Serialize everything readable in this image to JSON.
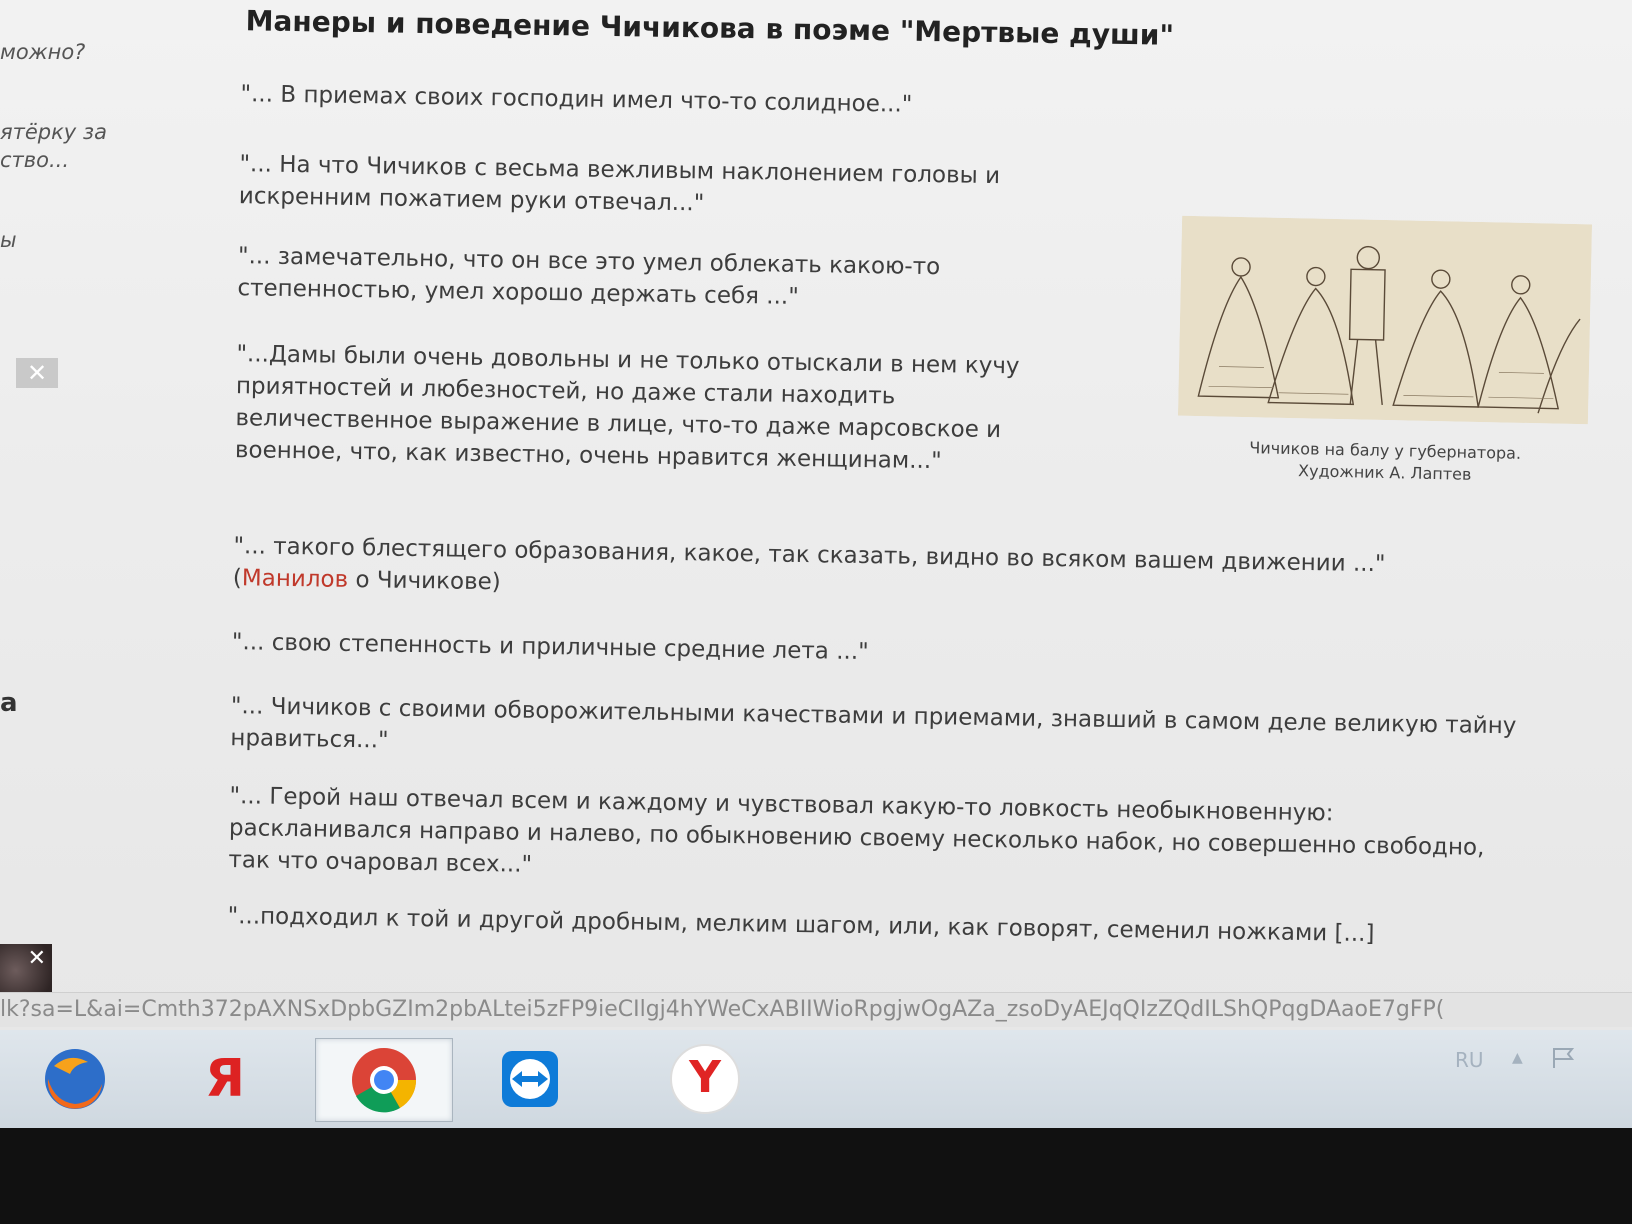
{
  "sidebar": {
    "frag1": "можно?",
    "frag2": "ятёрку за",
    "frag3": "ство...",
    "frag4": "ы",
    "frag5": "а",
    "close_glyph": "✕",
    "thumb_close_glyph": "✕"
  },
  "article": {
    "title": "Манеры и поведение Чичикова в поэме \"Мертвые души\"",
    "quotes": [
      {
        "text": "\"... В приемах своих господин имел что-то солидное...\""
      },
      {
        "text": "\"... На что Чичиков с весьма вежливым наклонением головы и искренним пожатием руки отвечал...\""
      },
      {
        "text": "\"... замечательно, что он все это умел облекать какою-то степенностью, умел хорошо держать себя ...\""
      },
      {
        "text": "\"...Дамы были очень довольны и не только отыскали в нем кучу приятностей и любезностей, но даже стали находить величественное выражение в лице, что-то даже марсовское и военное, что, как известно, очень нравится женщинам...\""
      },
      {
        "text": "\"... такого блестящего образования, какое, так сказать, видно во всяком вашем движении ...\"",
        "prefix": "(",
        "link": "Манилов",
        "suffix": " о Чичикове)"
      },
      {
        "text": "\"... свою степенность и приличные средние лета ...\""
      },
      {
        "text": "\"... Чичиков с своими обворожительными качествами и приемами, знавший в самом деле великую тайну нравиться...\""
      },
      {
        "text": "\"... Герой наш отвечал всем и каждому и чувствовал какую-то ловкость необыкновенную: раскланивался направо и налево, по обыкновению своему несколько набок, но совершенно свободно, так что очаровал всех...\""
      },
      {
        "text": "\"...подходил к той и другой дробным, мелким шагом, или, как говорят, семенил ножками [...]"
      }
    ],
    "caption_line1": "Чичиков на балу у губернатора.",
    "caption_line2": "Художник А. Лаптев"
  },
  "status_bar": {
    "url": "lk?sa=L&ai=Cmth372pAXNSxDpbGZIm2pbALtei5zFP9ieCIlgj4hYWeCxABIIWioRpgjwOgAZa_zsoDyAEJqQIzZQdILShQPqgDAaoE7gFP("
  },
  "taskbar": {
    "apps": [
      {
        "name": "firefox-icon"
      },
      {
        "name": "yandex-icon",
        "glyph": "Я"
      },
      {
        "name": "chrome-icon"
      },
      {
        "name": "teamviewer-icon"
      },
      {
        "name": "yandex-browser-icon",
        "glyph": "Y"
      }
    ],
    "language": "RU",
    "tray_arrow": "▲"
  },
  "colors": {
    "link": "#c0392b",
    "text": "#3d3d3d",
    "taskbar": "#d6dee5"
  }
}
